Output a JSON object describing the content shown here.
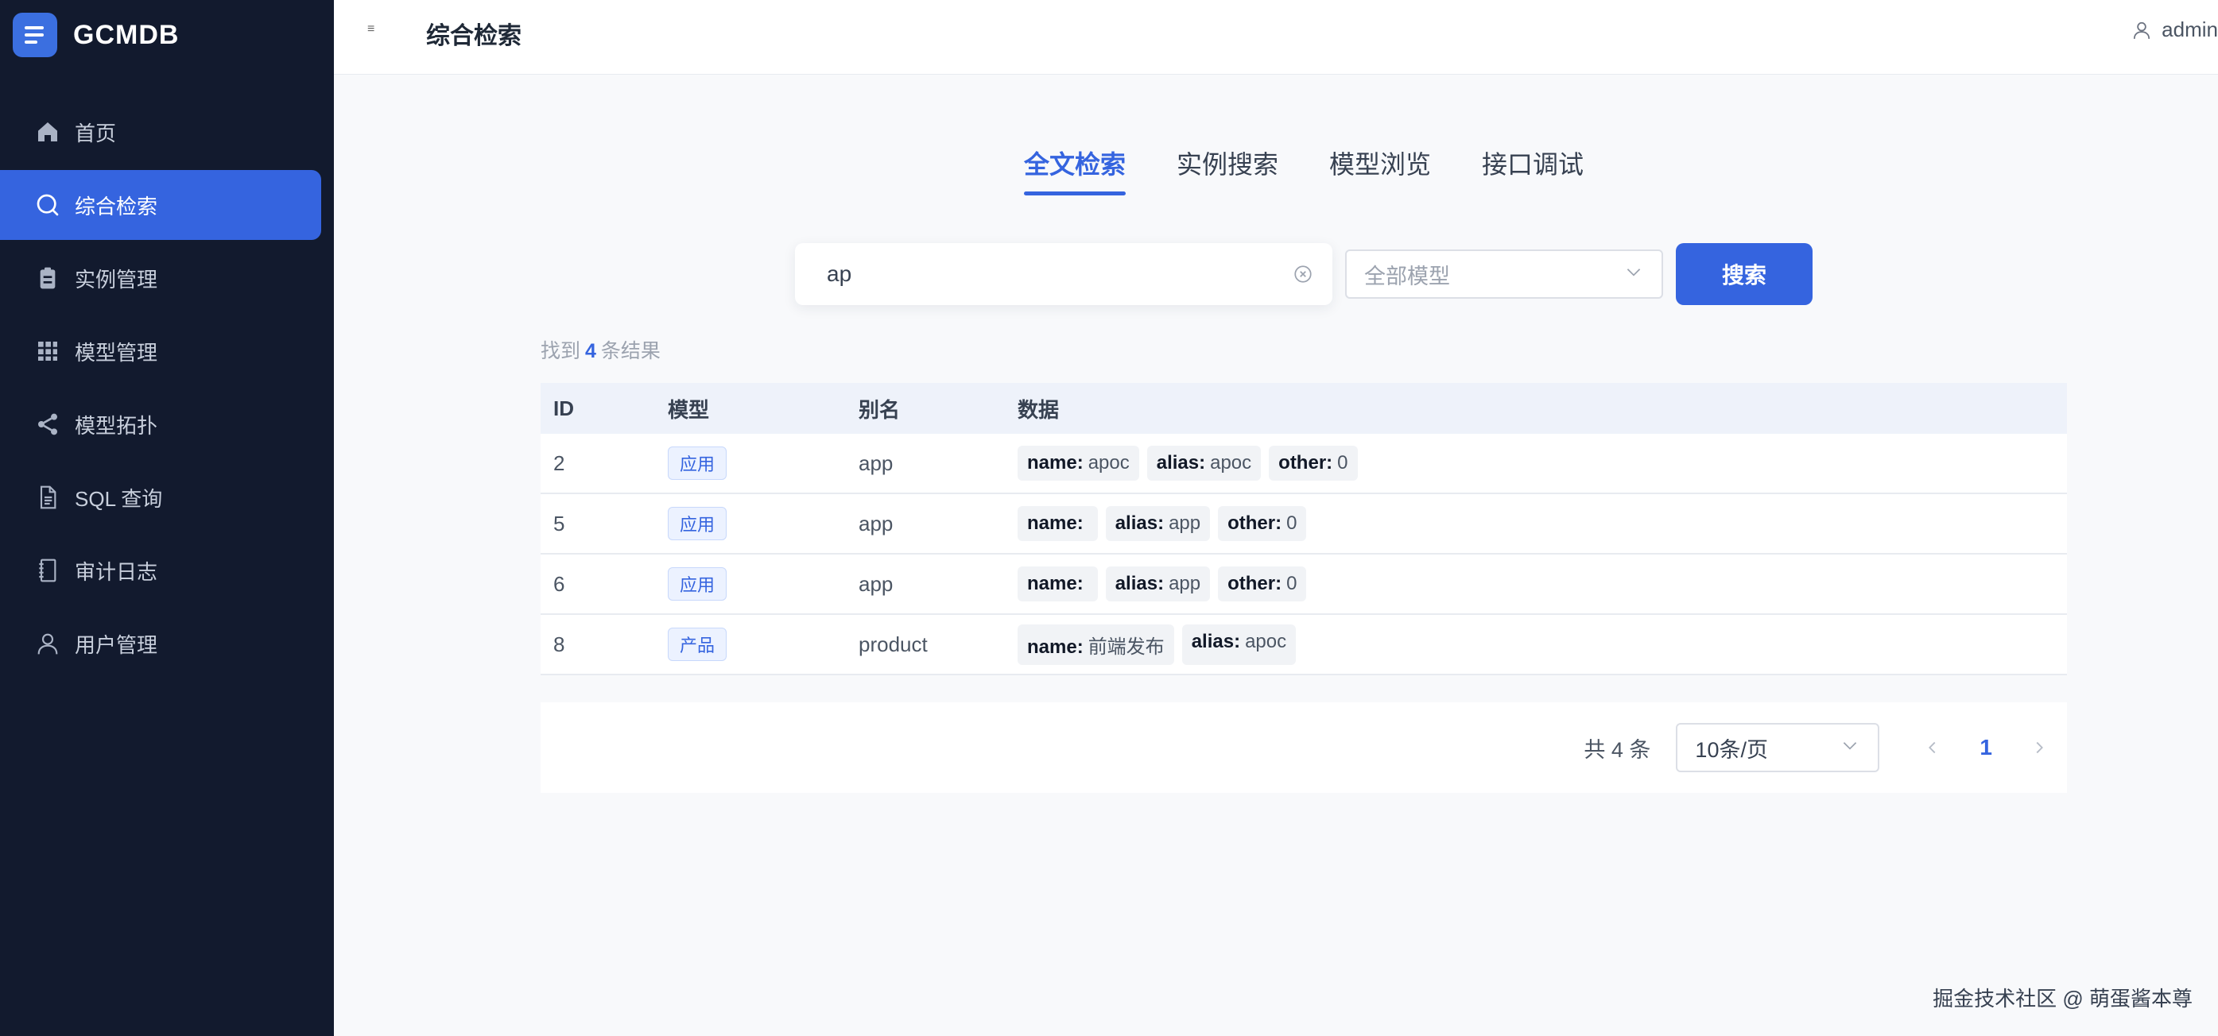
{
  "brand": {
    "name": "GCMDB"
  },
  "sidebar": {
    "items": [
      {
        "label": "首页",
        "icon": "home-icon"
      },
      {
        "label": "综合检索",
        "icon": "search-icon",
        "active": true
      },
      {
        "label": "实例管理",
        "icon": "clipboard-icon"
      },
      {
        "label": "模型管理",
        "icon": "grid-icon"
      },
      {
        "label": "模型拓扑",
        "icon": "share-icon"
      },
      {
        "label": "SQL 查询",
        "icon": "document-icon"
      },
      {
        "label": "审计日志",
        "icon": "notebook-icon"
      },
      {
        "label": "用户管理",
        "icon": "user-icon"
      }
    ]
  },
  "header": {
    "title": "综合检索",
    "user": "admin"
  },
  "tabs": [
    {
      "label": "全文检索",
      "active": true
    },
    {
      "label": "实例搜索"
    },
    {
      "label": "模型浏览"
    },
    {
      "label": "接口调试"
    }
  ],
  "search": {
    "value": "ap",
    "model_placeholder": "全部模型",
    "button": "搜索"
  },
  "summary": {
    "prefix": "找到",
    "count": "4",
    "suffix": "条结果"
  },
  "table": {
    "headers": {
      "id": "ID",
      "model": "模型",
      "alias": "别名",
      "data": "数据"
    },
    "rows": [
      {
        "id": "2",
        "model": "应用",
        "alias": "app",
        "data": [
          {
            "k": "name:",
            "v": "apoc"
          },
          {
            "k": "alias:",
            "v": "apoc"
          },
          {
            "k": "other:",
            "v": "0"
          }
        ]
      },
      {
        "id": "5",
        "model": "应用",
        "alias": "app",
        "data": [
          {
            "k": "name:",
            "v": ""
          },
          {
            "k": "alias:",
            "v": "app"
          },
          {
            "k": "other:",
            "v": "0"
          }
        ]
      },
      {
        "id": "6",
        "model": "应用",
        "alias": "app",
        "data": [
          {
            "k": "name:",
            "v": ""
          },
          {
            "k": "alias:",
            "v": "app"
          },
          {
            "k": "other:",
            "v": "0"
          }
        ]
      },
      {
        "id": "8",
        "model": "产品",
        "alias": "product",
        "data": [
          {
            "k": "name:",
            "v": "前端发布"
          },
          {
            "k": "alias:",
            "v": "apoc"
          }
        ]
      }
    ]
  },
  "pagination": {
    "total": "共 4 条",
    "page_size": "10条/页",
    "current": "1"
  },
  "watermark": "掘金技术社区 @ 萌蛋酱本尊",
  "colors": {
    "accent": "#3564df",
    "sidebar_bg": "#121a2e"
  }
}
